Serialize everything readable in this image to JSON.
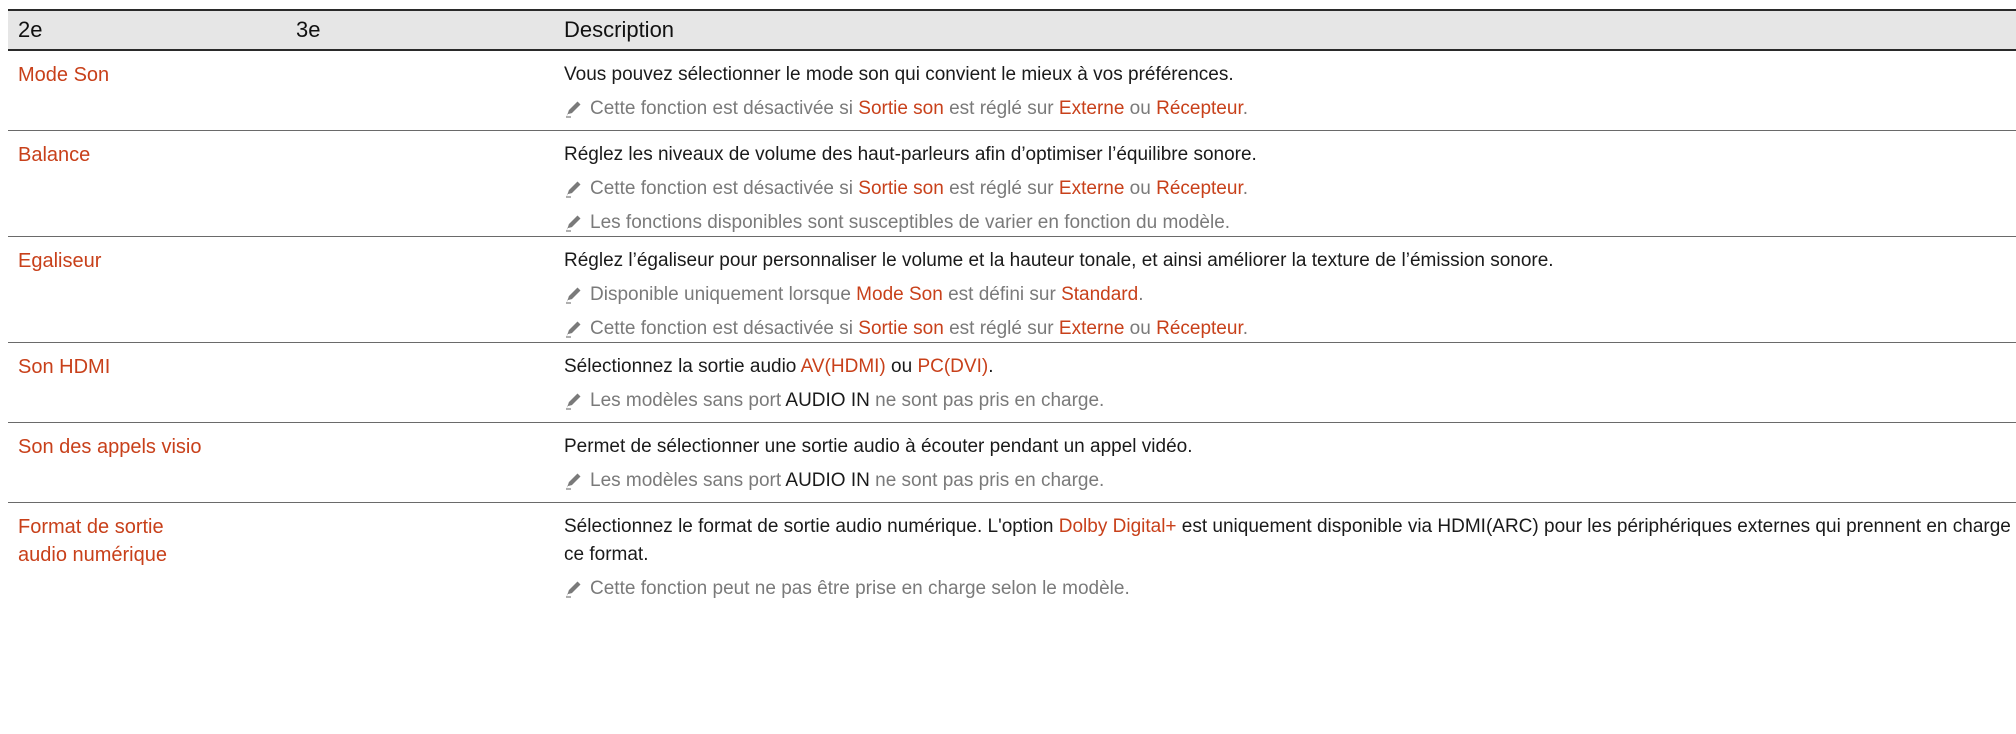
{
  "header": {
    "col_2e": "2e",
    "col_3e": "3e",
    "col_desc": "Description"
  },
  "colors": {
    "accent": "#c8401a",
    "note_gray": "#7a7a7a",
    "header_bg": "#e6e6e6",
    "rule": "#2a2a2a"
  },
  "icons": {
    "note": "pencil-icon"
  },
  "rows": [
    {
      "name": "Mode Son",
      "desc": "Vous pouvez sélectionner le mode son qui convient le mieux à vos préférences.",
      "notes": [
        {
          "t1": "Cette fonction est désactivée si ",
          "h1": "Sortie son",
          "t2": " est réglé sur ",
          "h2": "Externe",
          "t3": " ou ",
          "h3": "Récepteur",
          "t4": "."
        }
      ]
    },
    {
      "name": "Balance",
      "desc": "Réglez les niveaux de volume des haut-parleurs afin d’optimiser l’équilibre sonore.",
      "notes": [
        {
          "t1": "Cette fonction est désactivée si ",
          "h1": "Sortie son",
          "t2": " est réglé sur ",
          "h2": "Externe",
          "t3": " ou ",
          "h3": "Récepteur",
          "t4": "."
        },
        {
          "text": "Les fonctions disponibles sont susceptibles de varier en fonction du modèle."
        }
      ]
    },
    {
      "name": "Egaliseur",
      "desc": "Réglez l’égaliseur pour personnaliser le volume et la hauteur tonale, et ainsi améliorer la texture de l’émission sonore.",
      "notes": [
        {
          "t1": "Disponible uniquement lorsque ",
          "h1": "Mode Son",
          "t2": " est défini sur ",
          "h2": "Standard",
          "t3": "."
        },
        {
          "t1": "Cette fonction est désactivée si ",
          "h1": "Sortie son",
          "t2": " est réglé sur ",
          "h2": "Externe",
          "t3": " ou ",
          "h3": "Récepteur",
          "t4": "."
        }
      ]
    },
    {
      "name": "Son HDMI",
      "desc_t1": "Sélectionnez la sortie audio ",
      "desc_h1": "AV(HDMI)",
      "desc_t2": " ou ",
      "desc_h2": "PC(DVI)",
      "desc_t3": ".",
      "notes": [
        {
          "t1": "Les modèles sans port ",
          "d1": "AUDIO IN",
          "t2": " ne sont pas pris en charge."
        }
      ]
    },
    {
      "name": "Son des appels visio",
      "desc": "Permet de sélectionner une sortie audio à écouter pendant un appel vidéo.",
      "notes": [
        {
          "t1": "Les modèles sans port ",
          "d1": "AUDIO IN",
          "t2": " ne sont pas pris en charge."
        }
      ]
    },
    {
      "name": "Format de sortie audio numérique",
      "desc_t1": "Sélectionnez le format de sortie audio numérique. L'option ",
      "desc_h1": "Dolby Digital+",
      "desc_t2": " est uniquement disponible via HDMI(ARC) pour les périphériques externes qui prennent en charge ce format.",
      "notes": [
        {
          "text": "Cette fonction peut ne pas être prise en charge selon le modèle."
        }
      ]
    }
  ]
}
